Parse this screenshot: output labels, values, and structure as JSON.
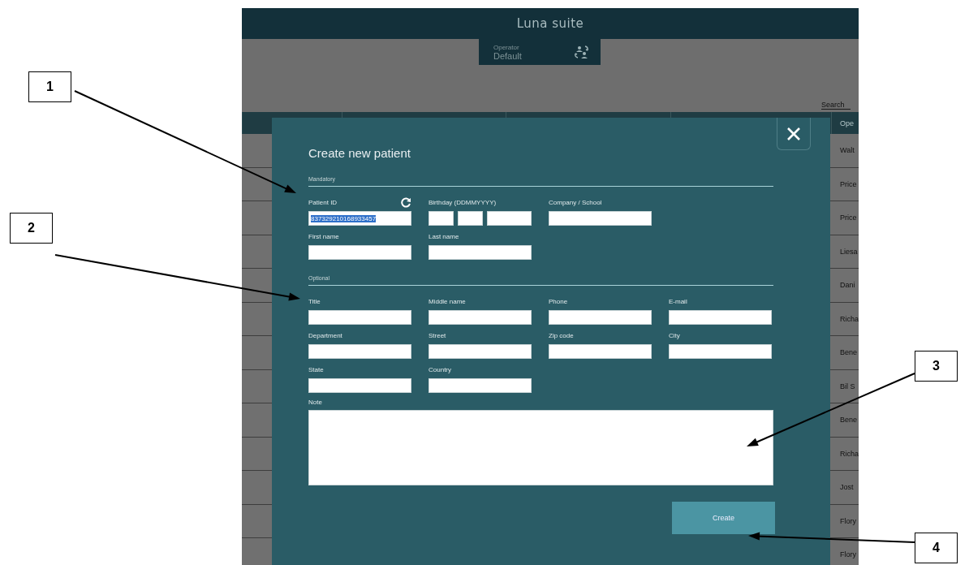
{
  "app": {
    "title": "Luna suite",
    "operator": {
      "label": "Operator",
      "value": "Default"
    },
    "search": {
      "placeholder": "Search"
    }
  },
  "table": {
    "column_header": "Ope",
    "rows": [
      "Walt",
      "Price",
      "Price",
      "Liesa",
      "Dani",
      "Richa",
      "Bene",
      "Bil S",
      "Bene",
      "Richa",
      "Jost",
      "Flory",
      "Flory"
    ]
  },
  "dialog": {
    "title": "Create new patient",
    "sections": [
      {
        "heading": "Mandatory",
        "rows": [
          [
            {
              "label": "Patient ID",
              "kind": "id",
              "value": "837329210168933457",
              "selected": true
            },
            {
              "label": "Birthday (DDMMYYYY)",
              "kind": "date"
            },
            {
              "label": "Company / School",
              "kind": "text"
            }
          ],
          [
            {
              "label": "First name",
              "kind": "text"
            },
            {
              "label": "Last name",
              "kind": "text"
            }
          ]
        ]
      },
      {
        "heading": "Optional",
        "rows": [
          [
            {
              "label": "Title",
              "kind": "text"
            },
            {
              "label": "Middle name",
              "kind": "text"
            },
            {
              "label": "Phone",
              "kind": "text"
            },
            {
              "label": "E-mail",
              "kind": "text"
            }
          ],
          [
            {
              "label": "Department",
              "kind": "text"
            },
            {
              "label": "Street",
              "kind": "text"
            },
            {
              "label": "Zip code",
              "kind": "text"
            },
            {
              "label": "City",
              "kind": "text"
            }
          ],
          [
            {
              "label": "State",
              "kind": "text"
            },
            {
              "label": "Country",
              "kind": "text"
            }
          ],
          [
            {
              "label": "Note",
              "kind": "note"
            }
          ]
        ]
      }
    ],
    "create_button": "Create"
  },
  "callouts": [
    {
      "label": "1"
    },
    {
      "label": "2"
    },
    {
      "label": "3"
    },
    {
      "label": "4"
    }
  ]
}
